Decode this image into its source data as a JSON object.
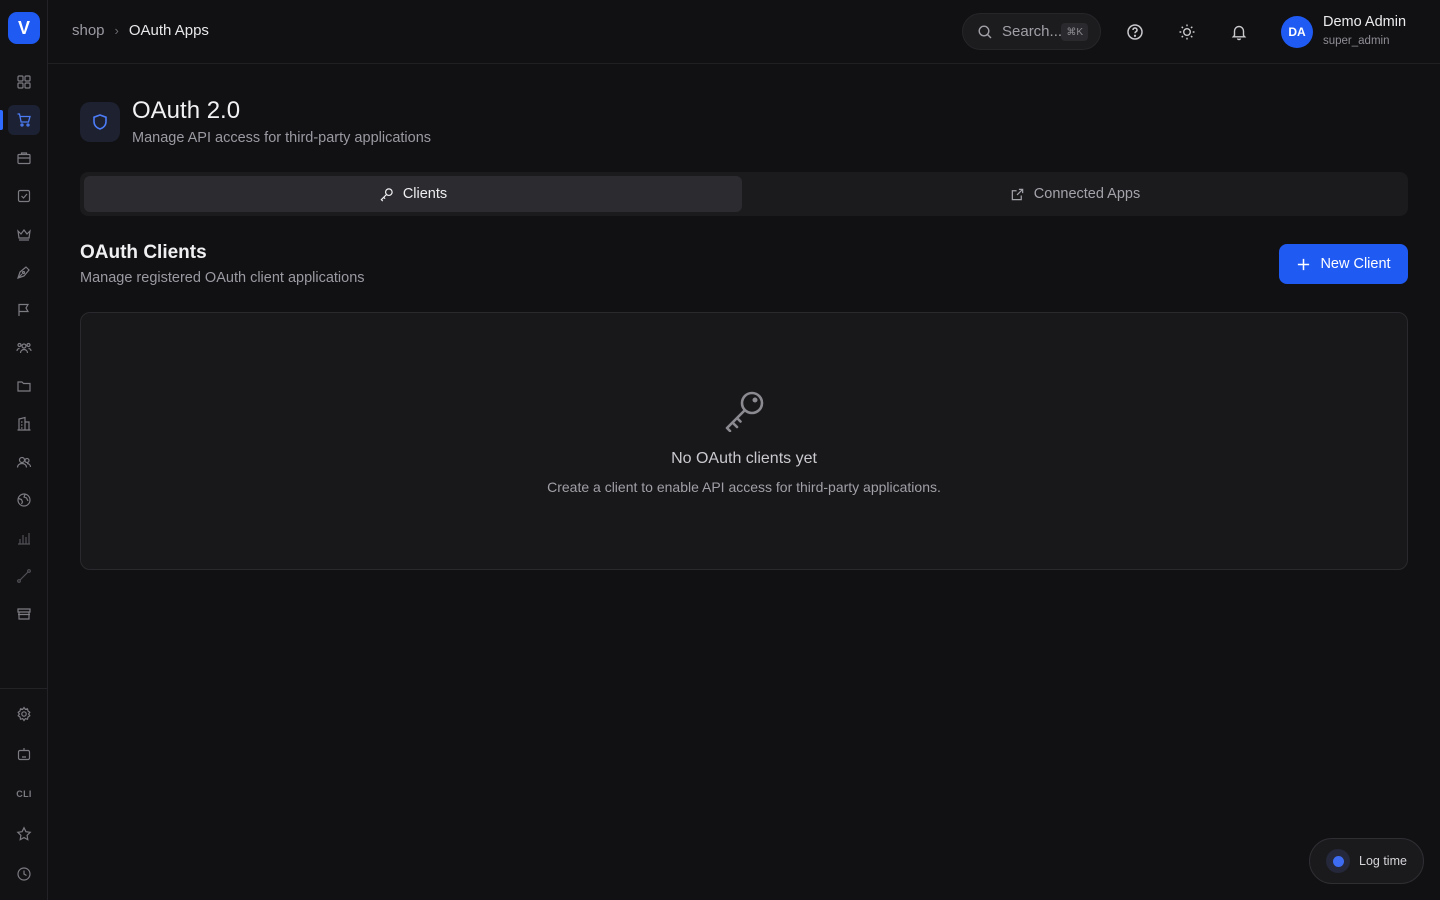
{
  "app": {
    "logo_letter": "V"
  },
  "sidebar": {
    "items": [
      {
        "name": "dashboard-icon"
      },
      {
        "name": "cart-icon",
        "active": true
      },
      {
        "name": "briefcase-icon"
      },
      {
        "name": "checkbox-icon"
      },
      {
        "name": "crown-icon"
      },
      {
        "name": "pen-tool-icon"
      },
      {
        "name": "flag-icon"
      },
      {
        "name": "team-icon"
      },
      {
        "name": "folder-icon"
      },
      {
        "name": "building-icon"
      },
      {
        "name": "users-icon"
      },
      {
        "name": "globe-icon"
      },
      {
        "name": "bar-chart-icon"
      },
      {
        "name": "route-icon"
      },
      {
        "name": "store-icon"
      }
    ],
    "bottom": [
      {
        "name": "settings-icon"
      },
      {
        "name": "robot-icon"
      },
      {
        "name": "cli-icon",
        "label": "CLI"
      },
      {
        "name": "star-icon"
      },
      {
        "name": "clock-icon"
      }
    ]
  },
  "header": {
    "breadcrumb": {
      "parent": "shop",
      "current": "OAuth Apps"
    },
    "search": {
      "placeholder": "Search...",
      "shortcut": "⌘K"
    },
    "user": {
      "initials": "DA",
      "name": "Demo Admin",
      "role": "super_admin"
    }
  },
  "page": {
    "title": "OAuth 2.0",
    "subtitle": "Manage API access for third-party applications",
    "tabs": [
      {
        "label": "Clients",
        "active": true,
        "icon": "key-icon"
      },
      {
        "label": "Connected Apps",
        "active": false,
        "icon": "external-link-icon"
      }
    ],
    "section": {
      "title": "OAuth Clients",
      "subtitle": "Manage registered OAuth client applications",
      "new_button": "New Client"
    },
    "empty": {
      "title": "No OAuth clients yet",
      "message": "Create a client to enable API access for third-party applications."
    }
  },
  "logtime": {
    "label": "Log time"
  },
  "colors": {
    "accent": "#1f5af2",
    "background": "#111113",
    "card": "#18181b"
  }
}
